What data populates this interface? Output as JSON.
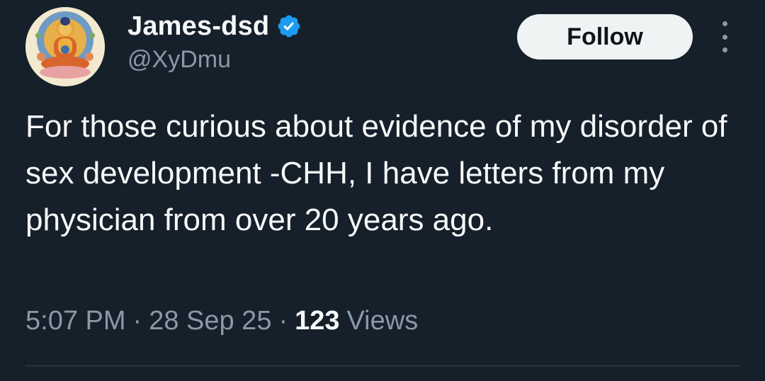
{
  "author": {
    "display_name": "James-dsd",
    "handle": "@XyDmu",
    "verified": true,
    "avatar_icon": "buddha-avatar-icon",
    "verified_icon": "verified-badge-icon"
  },
  "actions": {
    "follow_label": "Follow",
    "more_icon": "more-options-icon"
  },
  "tweet": {
    "text": "For those curious about evidence of my disorder of sex development -CHH, I have letters from my physician from over 20 years ago."
  },
  "meta": {
    "time": "5:07 PM",
    "separator": "·",
    "date": "28 Sep 25",
    "views_count": "123",
    "views_label": "Views"
  },
  "colors": {
    "background": "#15202b",
    "text_primary": "#f7f9f9",
    "text_secondary": "#8b98a5",
    "verified_blue": "#1d9bf0",
    "follow_button_bg": "#eff3f4",
    "divider": "#38444d"
  }
}
